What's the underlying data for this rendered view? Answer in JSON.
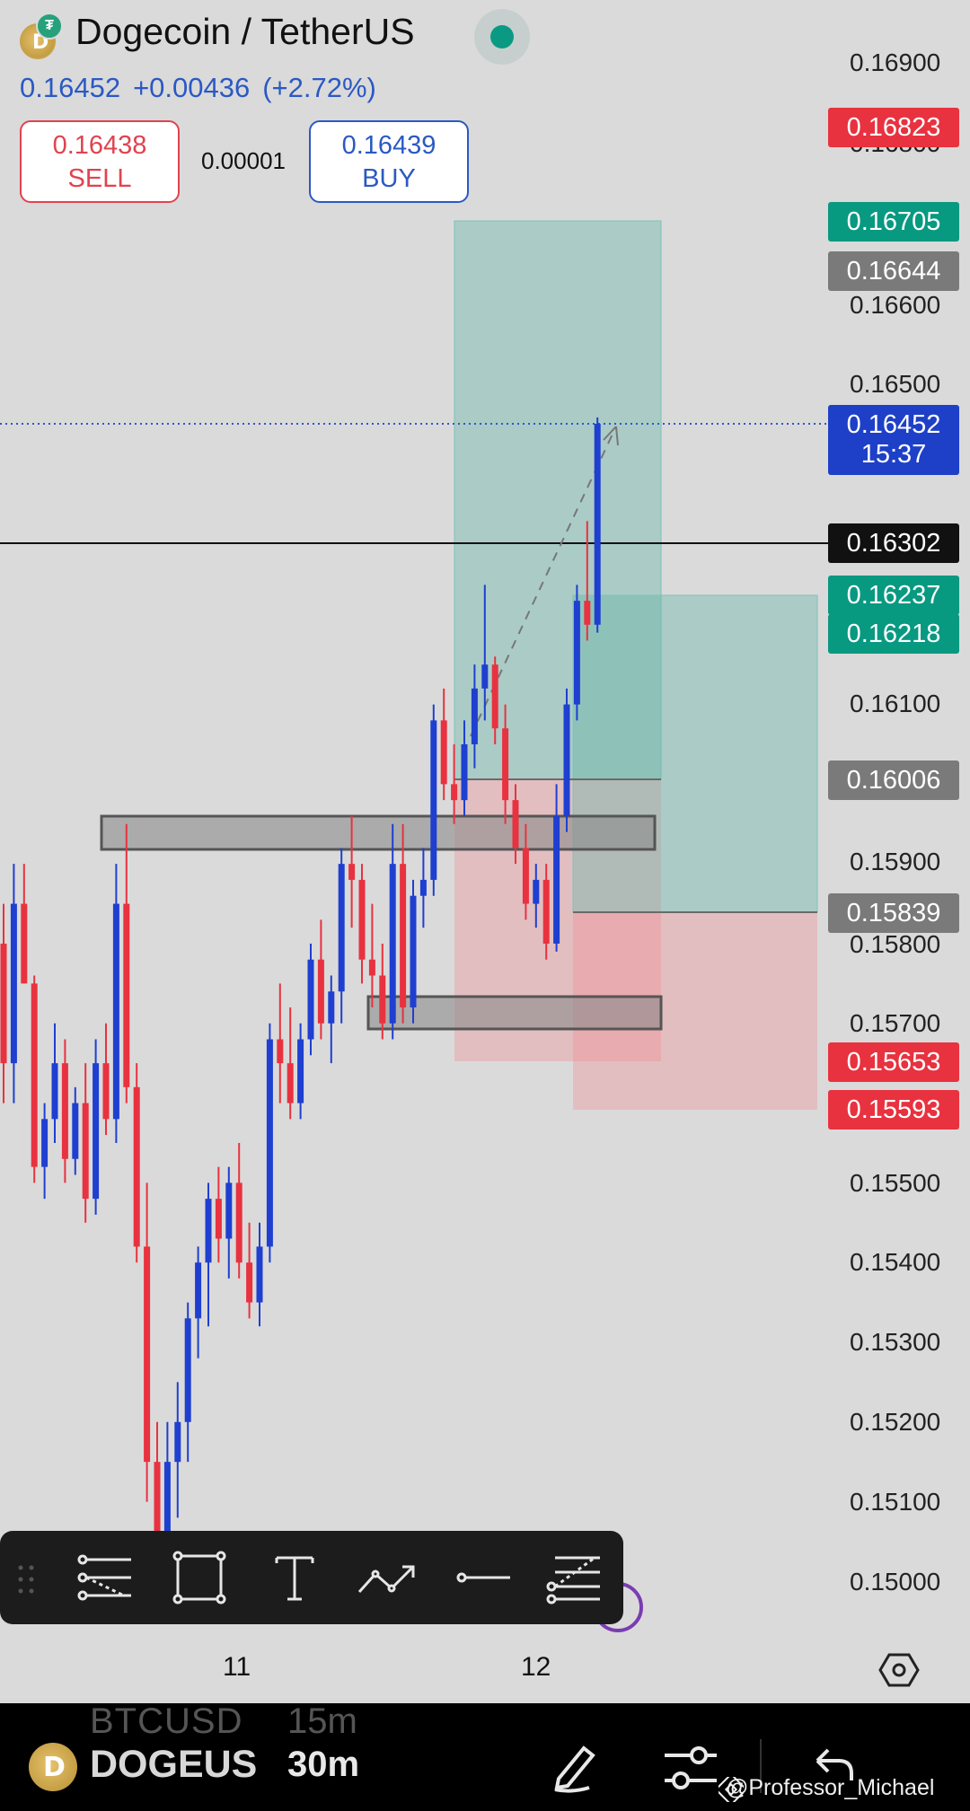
{
  "header": {
    "title": "Dogecoin / TetherUS",
    "last_price": "0.16452",
    "change": "+0.00436",
    "change_pct": "(+2.72%)",
    "live_color": "#0a9a84"
  },
  "trade": {
    "sell_price": "0.16438",
    "sell_label": "SELL",
    "spread": "0.00001",
    "buy_price": "0.16439",
    "buy_label": "BUY"
  },
  "price_axis": {
    "labels": [
      "0.16900",
      "0.16800",
      "0.16600",
      "0.16500",
      "0.16100",
      "0.15900",
      "0.15800",
      "0.15700",
      "0.15500",
      "0.15400",
      "0.15300",
      "0.15200",
      "0.15100",
      "0.15000"
    ],
    "tags": {
      "t16823": "0.16823",
      "t16705": "0.16705",
      "t16644": "0.16644",
      "last_price": "0.16452",
      "countdown": "15:37",
      "t16302": "0.16302",
      "t16237": "0.16237",
      "t16218": "0.16218",
      "t16006": "0.16006",
      "t15839": "0.15839",
      "t15653": "0.15653",
      "t15593": "0.15593"
    },
    "colors": {
      "red": "#e8323f",
      "green": "#089981",
      "gray": "#7a7a7a",
      "blue": "#1e40c8",
      "black": "#111111"
    }
  },
  "time_axis": {
    "labels": [
      "11",
      "12"
    ]
  },
  "drawing_toolbar": {
    "tools": [
      "trend-lines-icon",
      "rectangle-icon",
      "text-icon",
      "path-arrow-icon",
      "horizontal-ray-icon",
      "fib-levels-icon"
    ]
  },
  "bottom_bar": {
    "ghost_symbol": "BTCUSD",
    "ghost_timeframe": "15m",
    "symbol": "DOGEUS",
    "timeframe": "30m",
    "watermark": "@Professor_Michael"
  },
  "chart_data": {
    "type": "candlestick",
    "symbol": "DOGEUSDT",
    "interval": "30m",
    "ylim": [
      0.1496,
      0.1695
    ],
    "x_ticks": [
      "11",
      "12"
    ],
    "candles": [
      [
        0.158,
        0.1585,
        0.156,
        0.1565
      ],
      [
        0.1565,
        0.159,
        0.156,
        0.1585
      ],
      [
        0.1585,
        0.159,
        0.1575,
        0.1575
      ],
      [
        0.1575,
        0.1576,
        0.155,
        0.1552
      ],
      [
        0.1552,
        0.156,
        0.1548,
        0.1558
      ],
      [
        0.1558,
        0.157,
        0.1555,
        0.1565
      ],
      [
        0.1565,
        0.1568,
        0.155,
        0.1553
      ],
      [
        0.1553,
        0.1562,
        0.1551,
        0.156
      ],
      [
        0.156,
        0.1565,
        0.1545,
        0.1548
      ],
      [
        0.1548,
        0.1568,
        0.1546,
        0.1565
      ],
      [
        0.1565,
        0.157,
        0.1556,
        0.1558
      ],
      [
        0.1558,
        0.159,
        0.1555,
        0.1585
      ],
      [
        0.1585,
        0.1595,
        0.156,
        0.1562
      ],
      [
        0.1562,
        0.1565,
        0.154,
        0.1542
      ],
      [
        0.1542,
        0.155,
        0.151,
        0.1515
      ],
      [
        0.1515,
        0.152,
        0.1495,
        0.1496
      ],
      [
        0.1496,
        0.152,
        0.1495,
        0.1515
      ],
      [
        0.1515,
        0.1525,
        0.1508,
        0.152
      ],
      [
        0.152,
        0.1535,
        0.1515,
        0.1533
      ],
      [
        0.1533,
        0.1542,
        0.1528,
        0.154
      ],
      [
        0.154,
        0.155,
        0.1532,
        0.1548
      ],
      [
        0.1548,
        0.1552,
        0.154,
        0.1543
      ],
      [
        0.1543,
        0.1552,
        0.1538,
        0.155
      ],
      [
        0.155,
        0.1555,
        0.1538,
        0.154
      ],
      [
        0.154,
        0.1545,
        0.1533,
        0.1535
      ],
      [
        0.1535,
        0.1545,
        0.1532,
        0.1542
      ],
      [
        0.1542,
        0.157,
        0.154,
        0.1568
      ],
      [
        0.1568,
        0.1575,
        0.156,
        0.1565
      ],
      [
        0.1565,
        0.1572,
        0.1558,
        0.156
      ],
      [
        0.156,
        0.157,
        0.1558,
        0.1568
      ],
      [
        0.1568,
        0.158,
        0.1566,
        0.1578
      ],
      [
        0.1578,
        0.1583,
        0.1568,
        0.157
      ],
      [
        0.157,
        0.1576,
        0.1565,
        0.1574
      ],
      [
        0.1574,
        0.1592,
        0.157,
        0.159
      ],
      [
        0.159,
        0.1596,
        0.1582,
        0.1588
      ],
      [
        0.1588,
        0.159,
        0.1575,
        0.1578
      ],
      [
        0.1578,
        0.1585,
        0.1572,
        0.1576
      ],
      [
        0.1576,
        0.158,
        0.1568,
        0.157
      ],
      [
        0.157,
        0.1595,
        0.1568,
        0.159
      ],
      [
        0.159,
        0.1595,
        0.157,
        0.1572
      ],
      [
        0.1572,
        0.1588,
        0.157,
        0.1586
      ],
      [
        0.1586,
        0.1592,
        0.1582,
        0.1588
      ],
      [
        0.1588,
        0.161,
        0.1586,
        0.1608
      ],
      [
        0.1608,
        0.1612,
        0.1598,
        0.16
      ],
      [
        0.16,
        0.1605,
        0.1595,
        0.1598
      ],
      [
        0.1598,
        0.1608,
        0.1596,
        0.1605
      ],
      [
        0.1605,
        0.1615,
        0.1602,
        0.1612
      ],
      [
        0.1612,
        0.1625,
        0.1608,
        0.1615
      ],
      [
        0.1615,
        0.1616,
        0.1605,
        0.1607
      ],
      [
        0.1607,
        0.161,
        0.1595,
        0.1598
      ],
      [
        0.1598,
        0.16,
        0.159,
        0.1592
      ],
      [
        0.1592,
        0.1595,
        0.1583,
        0.1585
      ],
      [
        0.1585,
        0.159,
        0.1582,
        0.1588
      ],
      [
        0.1588,
        0.159,
        0.1578,
        0.158
      ],
      [
        0.158,
        0.16,
        0.1579,
        0.1596
      ],
      [
        0.1596,
        0.1612,
        0.1594,
        0.161
      ],
      [
        0.161,
        0.1625,
        0.1608,
        0.1623
      ],
      [
        0.1623,
        0.1633,
        0.1618,
        0.162
      ],
      [
        0.162,
        0.1646,
        0.1619,
        0.16452
      ]
    ]
  }
}
